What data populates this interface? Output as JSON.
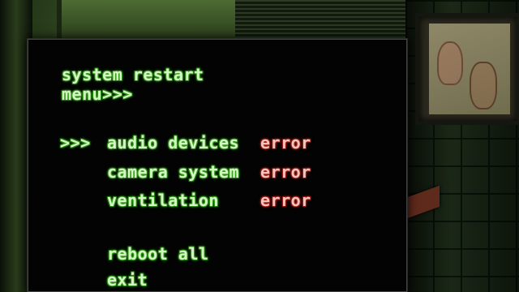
{
  "menu": {
    "title_line1": "system restart",
    "title_line2": "menu>>>",
    "cursor": ">>>",
    "items": [
      {
        "label": "audio devices",
        "status": "error"
      },
      {
        "label": "camera system",
        "status": "error"
      },
      {
        "label": "ventilation",
        "status": "error"
      }
    ],
    "actions": [
      {
        "label": "reboot all"
      },
      {
        "label": "exit"
      }
    ]
  },
  "colors": {
    "menu_text_glow": "#4fbf2c",
    "error_text_glow": "#c0271b",
    "terminal_background": "#020302"
  }
}
